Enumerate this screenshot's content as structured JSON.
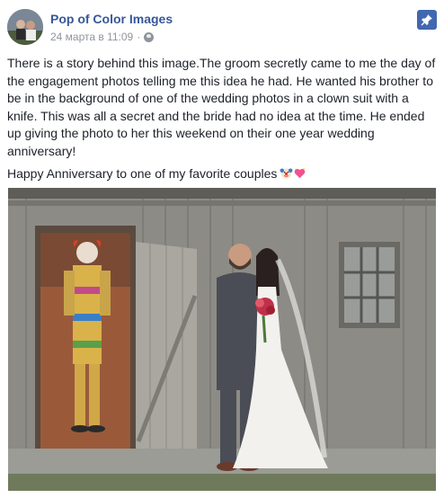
{
  "post": {
    "author": "Pop of Color Images",
    "timestamp": "24 марта в 11:09",
    "separator": "·",
    "privacy_icon": "globe-icon",
    "pin_icon": "pin-icon",
    "text": "There is a story behind this image.The groom secretly came to me the day of the engagement photos telling me this idea he had. He wanted his brother to be in the background of one of the wedding photos in a clown suit with a knife. This was all a secret and the bride had no idea at the time. He ended up giving the photo to her this weekend on their one year wedding anniversary!",
    "text2": "Happy Anniversary to one of my favorite couples",
    "emojis": [
      "clown-emoji",
      "heart-emoji"
    ]
  },
  "colors": {
    "link": "#365899",
    "meta": "#90949c",
    "accent": "#4267b2",
    "text": "#1d2129"
  }
}
